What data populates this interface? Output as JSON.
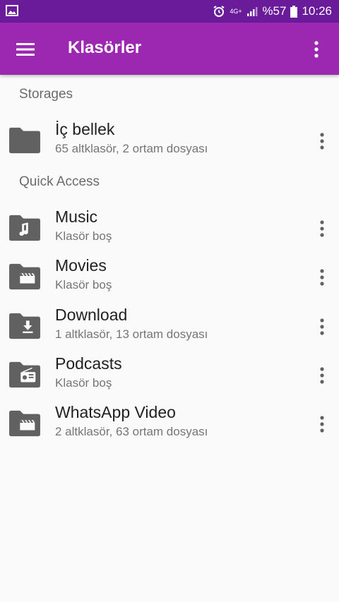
{
  "status_bar": {
    "battery_percent": "%57",
    "time": "10:26",
    "network": "4G+",
    "icons": [
      "image-icon",
      "alarm-icon",
      "network-4g-icon",
      "signal-icon",
      "battery-icon"
    ]
  },
  "app_bar": {
    "title": "Klasörler",
    "menu_icon": "hamburger-menu-icon",
    "overflow_icon": "more-vert-icon"
  },
  "sections": {
    "storages": {
      "title": "Storages",
      "items": [
        {
          "name": "İç bellek",
          "subtitle": "65 altklasör, 2 ortam dosyası",
          "icon": "folder-icon"
        }
      ]
    },
    "quick_access": {
      "title": "Quick Access",
      "items": [
        {
          "name": "Music",
          "subtitle": "Klasör boş",
          "icon": "music-folder-icon"
        },
        {
          "name": "Movies",
          "subtitle": "Klasör boş",
          "icon": "movies-folder-icon"
        },
        {
          "name": "Download",
          "subtitle": "1 altklasör, 13 ortam dosyası",
          "icon": "download-folder-icon"
        },
        {
          "name": "Podcasts",
          "subtitle": "Klasör boş",
          "icon": "podcasts-folder-icon"
        },
        {
          "name": "WhatsApp Video",
          "subtitle": "2 altklasör, 63 ortam dosyası",
          "icon": "video-folder-icon"
        }
      ]
    }
  },
  "colors": {
    "status_bar": "#6a1b9a",
    "app_bar": "#9c27b0",
    "folder_icon": "#616161",
    "background": "#fafafa"
  }
}
